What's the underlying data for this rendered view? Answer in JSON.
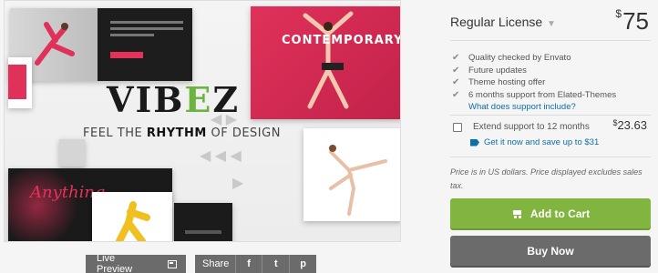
{
  "preview": {
    "logo_main": "VIB",
    "logo_accent": "E",
    "logo_tail": "Z",
    "tagline_light": "FEEL THE ",
    "tagline_bold": "RHYTHM",
    "tagline_end": " OF DESIGN",
    "card_title": "CONTEMPORARY",
    "anything_text": "Anything"
  },
  "actions": {
    "live_preview_label": "Live Preview",
    "share_label": "Share",
    "facebook_glyph": "f",
    "twitter_glyph": "t",
    "pinterest_glyph": "p"
  },
  "license": {
    "title": "Regular License",
    "currency": "$",
    "price": "75",
    "features": [
      "Quality checked by Envato",
      "Future updates",
      "Theme hosting offer",
      "6 months support from Elated-Themes"
    ],
    "support_link": "What does support include?",
    "extend_label": "Extend support to 12 months",
    "extend_currency": "$",
    "extend_price": "23.63",
    "save_text": "Get it now and save up to $31",
    "price_note": "Price is in US dollars. Price displayed excludes sales tax."
  },
  "buttons": {
    "add_to_cart": "Add to Cart",
    "buy_now": "Buy Now"
  },
  "colors": {
    "accent_green": "#82b440",
    "link_blue": "#0d6ea8",
    "brand_pink": "#e0315a"
  }
}
